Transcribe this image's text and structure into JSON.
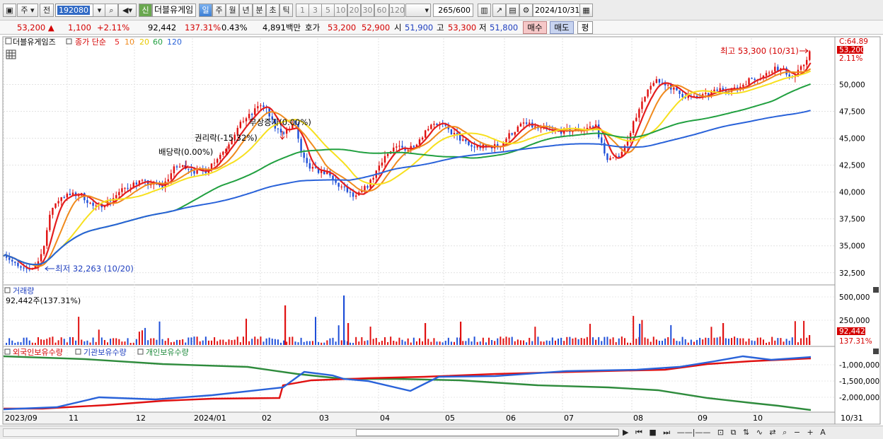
{
  "toolbar": {
    "jong_label": "주",
    "jeon_label": "전",
    "stock_code": "192080",
    "shin_label": "신",
    "stock_name": "더블유게임",
    "periods": [
      "일",
      "주",
      "월",
      "년",
      "분",
      "초",
      "틱"
    ],
    "intervals": [
      "1",
      "3",
      "5",
      "10",
      "20",
      "30",
      "60",
      "120"
    ],
    "count": "265/600",
    "date": "2024/10/31"
  },
  "quote": {
    "price": "53,200",
    "change": "1,100",
    "change_pct": "+2.11%",
    "volume": "92,442",
    "volume_ratio": "137.31%",
    "turnover": "0.43%",
    "amount": "4,891백만",
    "hoga_label": "호가",
    "ask": "53,200",
    "bid": "52,900",
    "open_label": "시",
    "open": "51,900",
    "high_label": "고",
    "high": "53,300",
    "low_label": "저",
    "low": "51,800",
    "buy_label": "매수",
    "sell_label": "매도",
    "pyeong_label": "평"
  },
  "price_panel": {
    "title": "더블유게임즈",
    "legend_prefix": "종가 단순",
    "ma_periods": [
      "5",
      "10",
      "20",
      "60",
      "120"
    ],
    "ma_colors": [
      "#e41e1e",
      "#f08a1d",
      "#f7e01e",
      "#21a040",
      "#2962d9"
    ],
    "top_label": "C:64.89",
    "last_price_tag": "53,200",
    "last_pct_tag": "2.11%",
    "annotations": {
      "high": "최고 53,300 (10/31)",
      "low": "최저 32,263 (10/20)",
      "div1": "배당락(0.00%)",
      "div2": "권리락(-15.32%)",
      "div3": "무상증자(0.00%)"
    },
    "y_ticks": [
      "50,000",
      "47,500",
      "45,000",
      "42,500",
      "40,000",
      "37,500",
      "35,000",
      "32,500"
    ]
  },
  "volume_panel": {
    "title": "거래량",
    "info": "92,442주(137.31%)",
    "y_ticks": [
      "500,000",
      "250,000"
    ],
    "last_tag": "92,442",
    "last_pct_tag": "137.31%"
  },
  "holding_panel": {
    "legend": [
      "외국인보유수량",
      "기관보유수량",
      "개인보유수량"
    ],
    "y_ticks": [
      "-1,000,000",
      "-1,500,000",
      "-2,000,000"
    ]
  },
  "x_axis": {
    "labels": [
      "2023/09",
      "11",
      "12",
      "2024/01",
      "02",
      "03",
      "04",
      "05",
      "06",
      "07",
      "08",
      "09",
      "10"
    ],
    "right_label": "10/31"
  },
  "chart_data": {
    "type": "line",
    "y_range": [
      31500,
      54300
    ],
    "close_keypoints": [
      [
        0,
        34300
      ],
      [
        15,
        33000
      ],
      [
        25,
        32600
      ],
      [
        35,
        33400
      ],
      [
        40,
        34400
      ],
      [
        50,
        38500
      ],
      [
        60,
        39600
      ],
      [
        80,
        39800
      ],
      [
        95,
        38500
      ],
      [
        110,
        39200
      ],
      [
        125,
        40300
      ],
      [
        140,
        41000
      ],
      [
        150,
        40800
      ],
      [
        165,
        40500
      ],
      [
        178,
        42300
      ],
      [
        190,
        42400
      ],
      [
        200,
        41800
      ],
      [
        210,
        42000
      ],
      [
        220,
        43000
      ],
      [
        230,
        44000
      ],
      [
        240,
        45500
      ],
      [
        250,
        46800
      ],
      [
        258,
        47200
      ],
      [
        265,
        48200
      ],
      [
        273,
        47600
      ],
      [
        283,
        45800
      ],
      [
        292,
        45600
      ],
      [
        303,
        46300
      ],
      [
        309,
        43500
      ],
      [
        316,
        42300
      ],
      [
        325,
        42000
      ],
      [
        335,
        41800
      ],
      [
        345,
        40800
      ],
      [
        355,
        40200
      ],
      [
        365,
        39400
      ],
      [
        380,
        40800
      ],
      [
        395,
        43300
      ],
      [
        410,
        44200
      ],
      [
        420,
        44000
      ],
      [
        430,
        44700
      ],
      [
        445,
        46500
      ],
      [
        455,
        46200
      ],
      [
        470,
        45200
      ],
      [
        485,
        44200
      ],
      [
        500,
        44200
      ],
      [
        515,
        44300
      ],
      [
        525,
        45300
      ],
      [
        540,
        46400
      ],
      [
        555,
        45900
      ],
      [
        570,
        45600
      ],
      [
        585,
        45700
      ],
      [
        600,
        45800
      ],
      [
        615,
        46200
      ],
      [
        625,
        43200
      ],
      [
        635,
        43000
      ],
      [
        645,
        44200
      ],
      [
        655,
        46700
      ],
      [
        665,
        48600
      ],
      [
        675,
        50300
      ],
      [
        690,
        50000
      ],
      [
        700,
        49200
      ],
      [
        715,
        48700
      ],
      [
        730,
        49000
      ],
      [
        745,
        49600
      ],
      [
        760,
        49500
      ],
      [
        775,
        50500
      ],
      [
        790,
        50800
      ],
      [
        800,
        51600
      ],
      [
        810,
        51300
      ],
      [
        820,
        50600
      ],
      [
        830,
        51700
      ],
      [
        838,
        53200
      ]
    ],
    "ma5": "MA(5)",
    "ma10": "MA(10)",
    "ma20": "MA(20)",
    "ma60": "MA(60)",
    "ma120": "MA(120)"
  }
}
